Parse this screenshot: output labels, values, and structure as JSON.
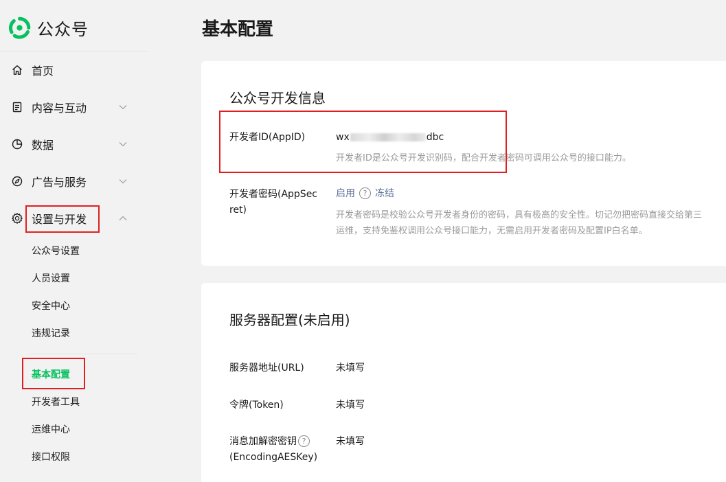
{
  "app": {
    "brand_name": "公众号",
    "page_title": "基本配置"
  },
  "sidebar": {
    "items": [
      {
        "label": "首页",
        "icon": "home-icon"
      },
      {
        "label": "内容与互动",
        "icon": "document-icon",
        "expandable": true
      },
      {
        "label": "数据",
        "icon": "pie-chart-icon",
        "expandable": true
      },
      {
        "label": "广告与服务",
        "icon": "compass-icon",
        "expandable": true
      },
      {
        "label": "设置与开发",
        "icon": "gear-icon",
        "expandable": true,
        "expanded": true
      }
    ],
    "sub_items": [
      "公众号设置",
      "人员设置",
      "安全中心",
      "违规记录",
      "基本配置",
      "开发者工具",
      "运维中心",
      "接口权限"
    ],
    "active_sub_item": "基本配置"
  },
  "dev_info": {
    "title": "公众号开发信息",
    "appid_label": "开发者ID(AppID)",
    "appid_prefix": "wx",
    "appid_suffix": "dbc",
    "appid_desc": "开发者ID是公众号开发识别码，配合开发者密码可调用公众号的接口能力。",
    "secret_label_1": "开发者密码(AppSec",
    "secret_label_2": "ret)",
    "enable_link": "启用",
    "freeze_link": "冻结",
    "secret_desc_1": "开发者密码是校验公众号开发者身份的密码，具有极高的安全性。切记勿把密码直接交给第三",
    "secret_desc_2": "运维，支持免鉴权调用公众号接口能力，无需启用开发者密码及配置IP白名单。"
  },
  "server_config": {
    "title": "服务器配置(未启用)",
    "url_label": "服务器地址(URL)",
    "url_value": "未填写",
    "token_label": "令牌(Token)",
    "token_value": "未填写",
    "aes_label_1": "消息加解密密钥",
    "aes_label_2": "(EncodingAESKey)",
    "aes_value": "未填写"
  },
  "colors": {
    "accent": "#07c160",
    "link": "#576b95",
    "highlight_box": "#e02020"
  }
}
